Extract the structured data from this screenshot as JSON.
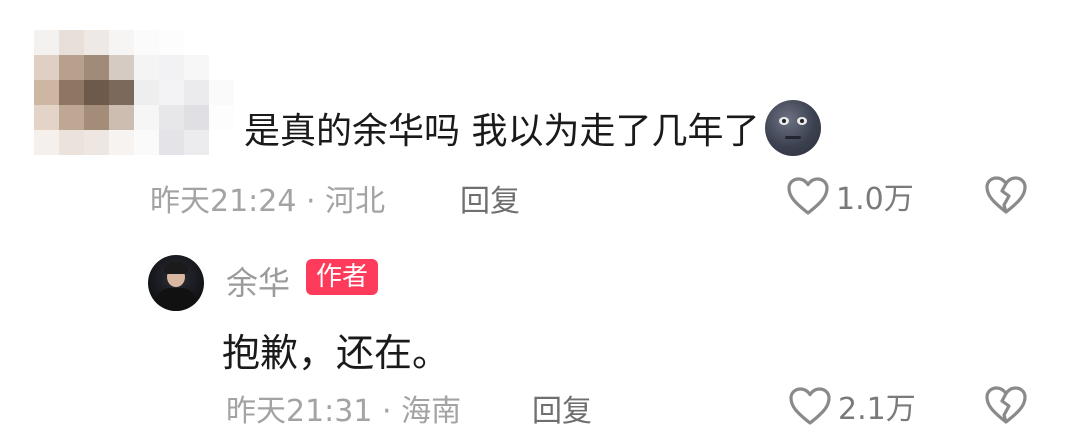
{
  "comment": {
    "text": "是真的余华吗 我以为走了几年了",
    "emoji": "new-moon-face-emoji",
    "time_location": "昨天21:24 · 河北",
    "reply_label": "回复",
    "likes": "1.0万"
  },
  "reply": {
    "author_name": "余华",
    "author_badge": "作者",
    "text": "抱歉，还在。",
    "time_location": "昨天21:31 · 海南",
    "reply_label": "回复",
    "likes": "2.1万"
  },
  "colors": {
    "badge": "#ff3b5c",
    "meta_text": "#a3a3a3",
    "body_text": "#1a1a1a"
  },
  "icons": [
    "heart-icon",
    "broken-heart-icon"
  ]
}
